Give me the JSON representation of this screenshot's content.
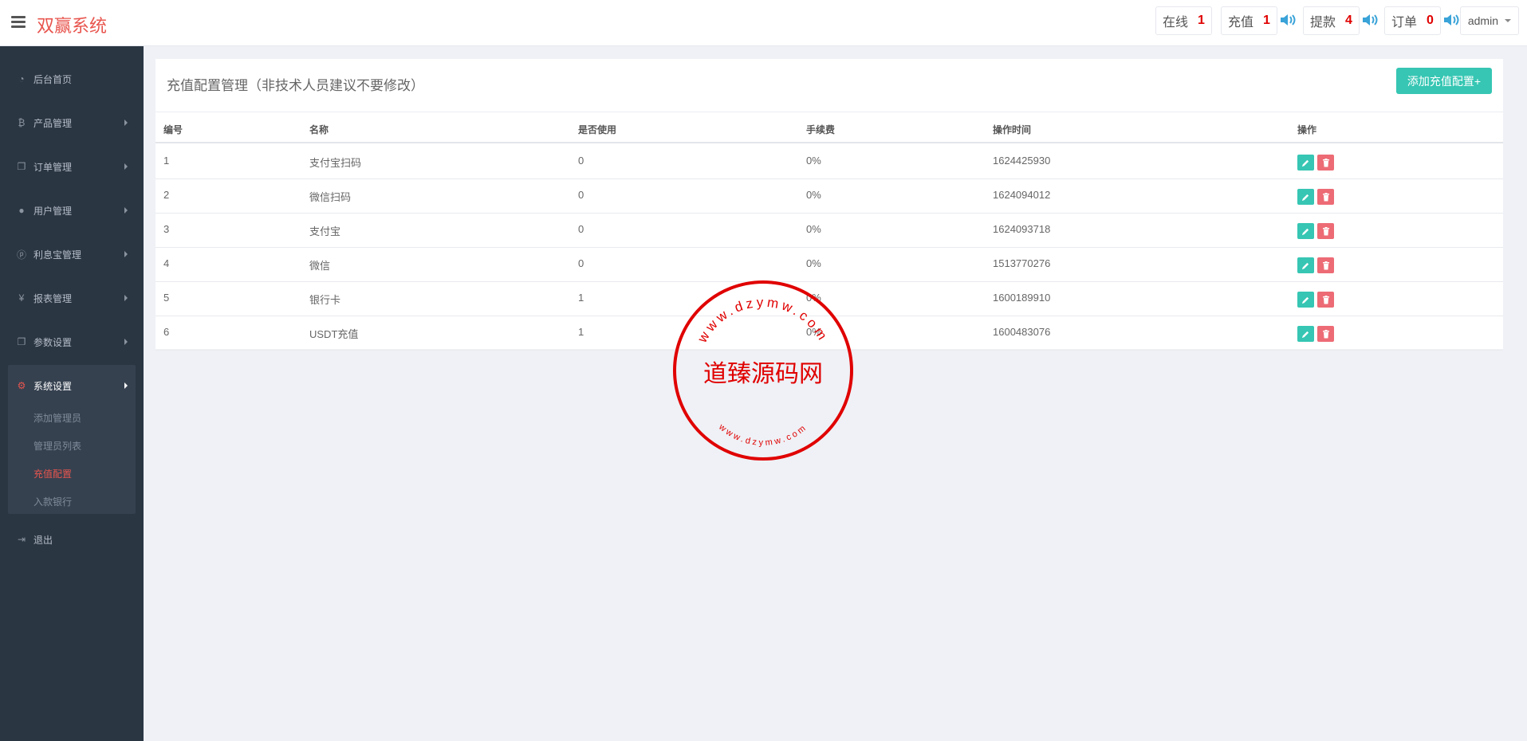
{
  "app": {
    "brand": "双赢系统"
  },
  "header": {
    "stats": [
      {
        "label": "在线",
        "value": "1"
      },
      {
        "label": "充值",
        "value": "1"
      },
      {
        "label": "提款",
        "value": "4"
      },
      {
        "label": "订单",
        "value": "0"
      }
    ],
    "user": "admin"
  },
  "sidebar": {
    "items": [
      {
        "label": "后台首页",
        "icon": "dashboard-icon"
      },
      {
        "label": "产品管理",
        "icon": "bitcoin-icon"
      },
      {
        "label": "订单管理",
        "icon": "copy-icon"
      },
      {
        "label": "用户管理",
        "icon": "user-icon"
      },
      {
        "label": "利息宝管理",
        "icon": "pinterest-icon"
      },
      {
        "label": "报表管理",
        "icon": "yen-icon"
      },
      {
        "label": "参数设置",
        "icon": "copy-icon"
      },
      {
        "label": "系统设置",
        "icon": "cogs-icon"
      },
      {
        "label": "退出",
        "icon": "sign-out-icon"
      }
    ],
    "sub_items": [
      "添加管理员",
      "管理员列表",
      "充值配置",
      "入款银行"
    ]
  },
  "panel": {
    "title": "充值配置管理（非技术人员建议不要修改）",
    "add_button": "添加充值配置+",
    "columns": [
      "编号",
      "名称",
      "是否使用",
      "手续费",
      "操作时间",
      "操作"
    ],
    "rows": [
      [
        "1",
        "支付宝扫码",
        "0",
        "0%",
        "1624425930"
      ],
      [
        "2",
        "微信扫码",
        "0",
        "0%",
        "1624094012"
      ],
      [
        "3",
        "支付宝",
        "0",
        "0%",
        "1624093718"
      ],
      [
        "4",
        "微信",
        "0",
        "0%",
        "1513770276"
      ],
      [
        "5",
        "银行卡",
        "1",
        "0%",
        "1600189910"
      ],
      [
        "6",
        "USDT充值",
        "1",
        "0%",
        "1600483076"
      ]
    ]
  },
  "watermark": {
    "text": "道臻源码网",
    "ring_text": "www.dzymw.com"
  },
  "colors": {
    "brand": "#e8554e",
    "sidebar": "#2b3643",
    "accent": "#36c6b3",
    "danger": "#ed6b75",
    "count": "#e00000",
    "stamp": "#e00000"
  }
}
